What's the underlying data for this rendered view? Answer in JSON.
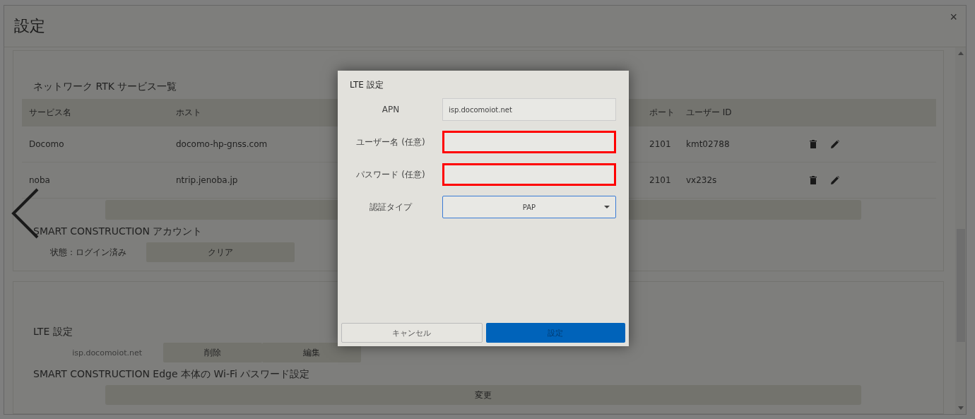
{
  "window": {
    "title": "設定",
    "close": "×"
  },
  "rtk": {
    "heading": "ネットワーク RTK サービス一覧",
    "columns": [
      "サービス名",
      "ホスト",
      "ポート",
      "ユーザー ID"
    ],
    "rows": [
      {
        "name": "Docomo",
        "host": "docomo-hp-gnss.com",
        "port": "2101",
        "user": "kmt02788"
      },
      {
        "name": "noba",
        "host": "ntrip.jenoba.jp",
        "port": "2101",
        "user": "vx232s"
      }
    ]
  },
  "account": {
    "heading": "SMART CONSTRUCTION アカウント",
    "status": "状態：ログイン済み",
    "button": "クリア"
  },
  "lte": {
    "heading": "LTE 設定",
    "apn": "isp.docomoiot.net",
    "buttons": [
      "削除",
      "編集"
    ]
  },
  "wifi": {
    "heading": "SMART CONSTRUCTION Edge 本体の Wi-Fi パスワード設定",
    "button": "変更"
  },
  "dialog": {
    "title": "LTE 設定",
    "fields": [
      {
        "kind": "text",
        "label": "APN",
        "value": "isp.docomoiot.net",
        "highlighted": false
      },
      {
        "kind": "text",
        "label": "ユーザー名 (任意)",
        "highlighted": true
      },
      {
        "kind": "text",
        "label": "パスワード (任意)",
        "highlighted": true
      },
      {
        "kind": "select",
        "label": "認証タイプ",
        "value": "PAP",
        "highlighted": false
      }
    ],
    "buttons": [
      {
        "label": "キャンセル",
        "kind": "secondary"
      },
      {
        "label": "設定",
        "kind": "primary"
      }
    ]
  }
}
